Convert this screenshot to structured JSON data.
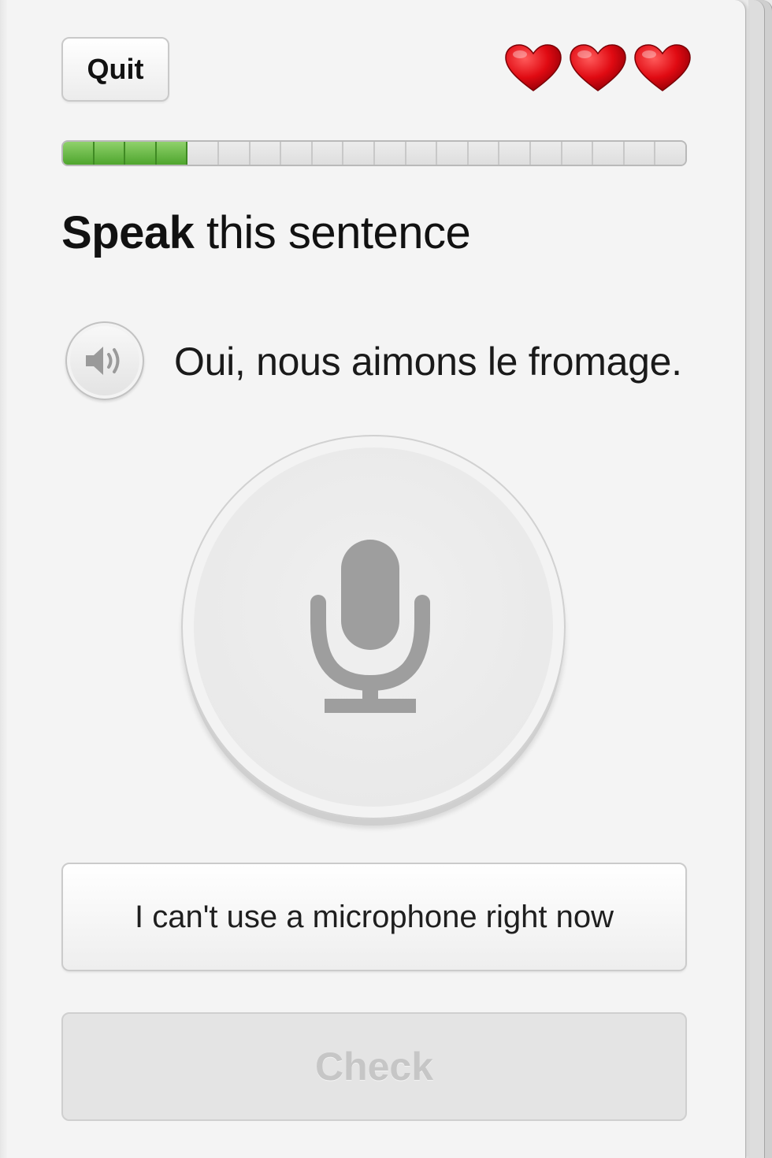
{
  "header": {
    "quit_label": "Quit",
    "hearts": [
      {
        "icon": "heart-icon",
        "color": "#d9000d"
      },
      {
        "icon": "heart-icon",
        "color": "#d9000d"
      },
      {
        "icon": "heart-icon",
        "color": "#d9000d"
      }
    ]
  },
  "progress": {
    "total_segments": 20,
    "completed_segments": 4,
    "fill_color": "#4ea52d"
  },
  "prompt": {
    "instruction_bold": "Speak",
    "instruction_rest": " this sentence",
    "speaker_icon": "speaker-icon",
    "sentence": "Oui, nous aimons le fromage."
  },
  "microphone": {
    "icon": "microphone-icon"
  },
  "actions": {
    "no_mic_label": "I can't use a microphone right now",
    "check_label": "Check"
  }
}
